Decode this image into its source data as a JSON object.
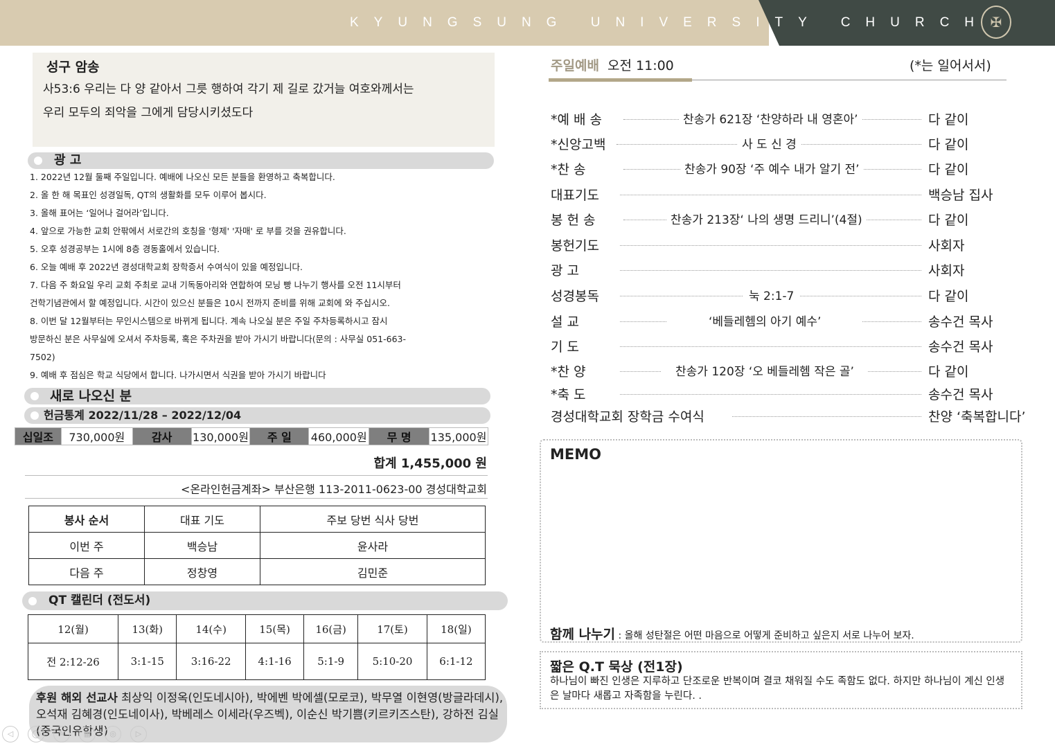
{
  "header": {
    "title": "KYUNGSUNG UNIVERSITY CHURCH"
  },
  "verse": {
    "title": "성구 암송",
    "line1": "사53:6 우리는 다 양 같아서 그릇 행하여 각기 제 길로 갔거늘 여호와께서는",
    "line2": "우리 모두의 죄악을 그에게 담당시키셨도다"
  },
  "announcements": {
    "title": "광   고",
    "items": [
      "1. 2022년 12월 둘째 주일입니다. 예배에 나오신 모든 분들을 환영하고 축복합니다.",
      "2. 올 한 해 목표인 성경일독, QT의 생활화를 모두 이루어 봅시다.",
      "3. 올해 표어는 ‘일어나 걸어라’입니다.",
      "4. 앞으로 가능한 교회 안팎에서 서로간의 호칭을 '형제' '자매' 로 부를 것을 권유합니다.",
      "5. 오후 성경공부는 1시에 8층 경동홀에서 있습니다.",
      "6. 오늘 예배 후 2022년 경성대학교회 장학증서 수여식이 있을 예정입니다.",
      "7. 다음 주 화요일 우리 교회 주최로 교내 기독동아리와 연합하여 모닝 빵 나누기 행사를 오전 11시부터",
      "건학기념관에서 할 예정입니다. 시간이 있으신 분들은 10시 전까지 준비를 위해 교회에 와 주십시오.",
      "8. 이번 달 12월부터는 무인시스템으로 바뀌게 됩니다. 계속 나오실 분은 주일 주차등록하시고 잠시",
      "방문하신 분은 사무실에 오셔서 주차등록, 혹은 주차권을 받아 가시기 바랍니다(문의 : 사무실 051-663-",
      "7502)",
      "9. 예배 후 점심은 학교 식당에서 합니다. 나가시면서 식권을 받아 가시기 바랍니다"
    ]
  },
  "newcomers": {
    "title": "새로 나오신 분"
  },
  "offering": {
    "title": "헌금통계 2022/11/28 – 2022/12/04",
    "items": [
      {
        "label": "십일조",
        "amount": "730,000원"
      },
      {
        "label": "감사",
        "amount": "130,000원"
      },
      {
        "label": "주 일",
        "amount": "460,000원"
      },
      {
        "label": "무 명",
        "amount": "135,000원"
      }
    ],
    "total": "합계  1,455,000 원",
    "account": "<온라인헌금계좌> 부산은행 113-2011-0623-00 경성대학교회"
  },
  "service_table": {
    "headers": [
      "봉사 순서",
      "대표 기도",
      "주보 당번 식사 당번"
    ],
    "rows": [
      [
        "이번 주",
        "백승남",
        "윤사라"
      ],
      [
        "다음 주",
        "정창영",
        "김민준"
      ]
    ]
  },
  "qt": {
    "title": "QT 캘린더 (전도서)",
    "days": [
      "12(월)",
      "13(화)",
      "14(수)",
      "15(목)",
      "16(금)",
      "17(토)",
      "18(일)"
    ],
    "passages": [
      "전 2:12-26",
      "3:1-15",
      "3:16-22",
      "4:1-16",
      "5:1-9",
      "5:10-20",
      "6:1-12"
    ]
  },
  "missionaries": {
    "label": "후원 해외 선교사",
    "text": " 최상익 이정옥(인도네시아), 박에벤 박에셀(모로코), 박무열 이현영(방글라데시), 오석재 김혜경(인도네이사), 박베레스 이세라(우즈벡), 이순신 박기쁨(키르키즈스탄), 강하전 김실(중국인유학생)"
  },
  "nav": {
    "icons": [
      "◁",
      "◯",
      "✎",
      "▦",
      "◎",
      "▷"
    ]
  },
  "worship": {
    "title": "주일예배",
    "time": "오전 11:00",
    "note": "(*는 일어서서)",
    "rows": [
      {
        "label": "*예 배 송",
        "content": "찬송가 621장 ‘찬양하라 내 영혼아’",
        "leader": "다 같이"
      },
      {
        "label": "*신앙고백",
        "content": "사 도 신 경",
        "leader": "다 같이"
      },
      {
        "label": "*찬      송",
        "content": "찬송가 90장 ‘주 예수 내가 알기 전’",
        "leader": "다 같이"
      },
      {
        "label": " 대표기도",
        "content": "",
        "leader": "백승남 집사"
      },
      {
        "label": " 봉 헌 송",
        "content": "찬송가 213장‘ 나의 생명 드리니’(4절)",
        "leader": "다 같이"
      },
      {
        "label": " 봉헌기도",
        "content": "",
        "leader": "사회자"
      },
      {
        "label": " 광      고",
        "content": "",
        "leader": "사회자"
      },
      {
        "label": " 성경봉독",
        "content": "눅 2:1-7",
        "leader": "다 같이"
      },
      {
        "label": " 설      교",
        "content": "‘베들레헴의 아기 예수’",
        "leader": "송수건 목사"
      },
      {
        "label": " 기      도",
        "content": "",
        "leader": "송수건 목사"
      },
      {
        "label": "*찬      양",
        "content": "찬송가 120장  ‘오 베들레헴 작은 골’",
        "leader": "다 같이"
      },
      {
        "label": "*축      도",
        "content": "",
        "leader": "송수건 목사"
      },
      {
        "label": "경성대학교회 장학금 수여식",
        "content": "",
        "leader": "찬양 ‘축복합니다’"
      }
    ]
  },
  "memo": {
    "title": "MEMO",
    "share_label": "함께 나누기",
    "share_text": " : 올해 성탄절은 어떤 마음으로 어떻게 준비하고 싶은지 서로 나누어 보자."
  },
  "meditation": {
    "title": "짧은 Q.T 묵상 (전1장)",
    "text": "하나님이 빠진 인생은 지루하고 단조로운 반복이며 결코 채워질 수도 족함도 없다. 하지만 하나님이 계신 인생은 날마다 새롭고 자족함을 누린다. ."
  }
}
